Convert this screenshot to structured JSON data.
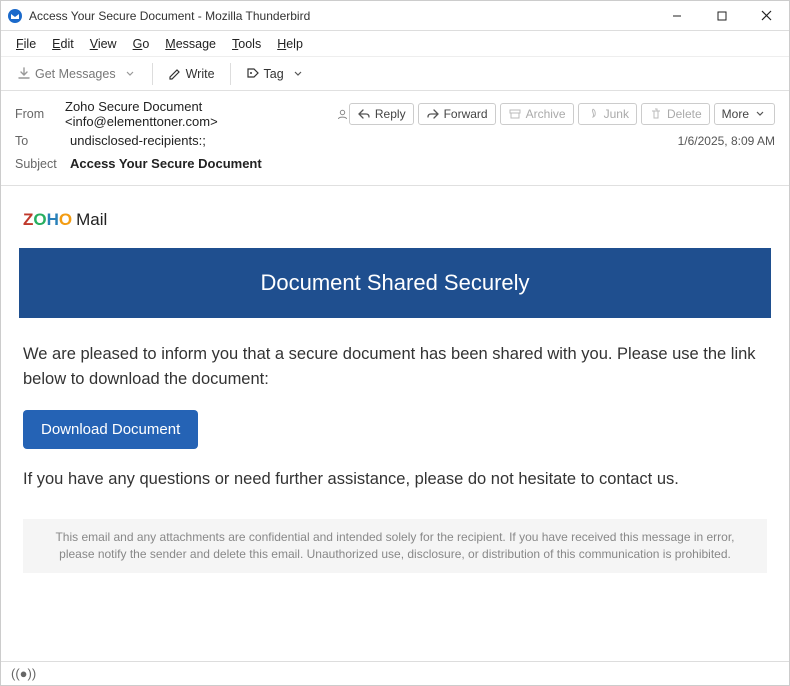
{
  "window": {
    "title": "Access Your Secure Document - Mozilla Thunderbird"
  },
  "menubar": [
    "File",
    "Edit",
    "View",
    "Go",
    "Message",
    "Tools",
    "Help"
  ],
  "toolbar": {
    "get_messages": "Get Messages",
    "write": "Write",
    "tag": "Tag"
  },
  "headers": {
    "from_label": "From",
    "from_value": "Zoho Secure Document <info@elementtoner.com>",
    "to_label": "To",
    "to_value": "undisclosed-recipients:;",
    "subject_label": "Subject",
    "subject_value": "Access Your Secure Document",
    "timestamp": "1/6/2025, 8:09 AM",
    "actions": {
      "reply": "Reply",
      "forward": "Forward",
      "archive": "Archive",
      "junk": "Junk",
      "delete": "Delete",
      "more": "More"
    }
  },
  "body": {
    "brand_mail": "Mail",
    "banner": "Document Shared Securely",
    "paragraph1": "We are pleased to inform you that a secure document has been shared with you. Please use the link below to download the document:",
    "download_button": "Download Document",
    "paragraph2": "If you have any questions or need further assistance, please do not hesitate to contact us.",
    "footnote": "This email and any attachments are confidential and intended solely for the recipient. If you have received this message in error, please notify the sender and delete this email. Unauthorized use, disclosure, or distribution of this communication is prohibited."
  }
}
